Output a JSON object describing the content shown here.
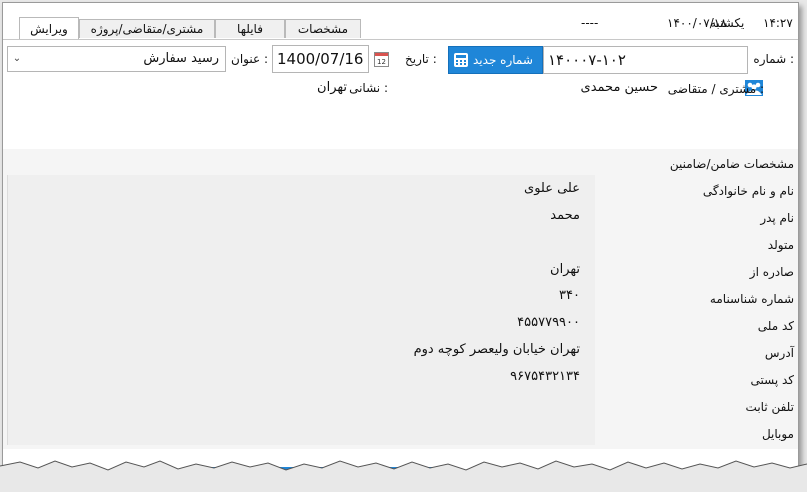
{
  "header": {
    "time": "۱۴:۲۷",
    "day": "یکشنبه",
    "date": "۱۴۰۰/۰۷/۱۸",
    "dashes": "----"
  },
  "tabs": [
    {
      "label": "ویرایش",
      "active": true
    },
    {
      "label": "مشتری/متقاضی/پروژه",
      "active": false
    },
    {
      "label": "فایلها",
      "active": false
    },
    {
      "label": "مشخصات",
      "active": false
    }
  ],
  "form": {
    "number_label": "شماره :",
    "number_value": "۱۴۰۰۰۷-۱۰۲",
    "new_number_button": "شماره جدید",
    "date_label": "تاریخ :",
    "date_value": "1400/07/16",
    "title_label": "عنوان :",
    "title_value": "رسید سفارش",
    "customer_label": "مشتری / متقاضی :",
    "customer_value": "حسین محمدی",
    "address_label": "نشانی :",
    "address_value": "تهران"
  },
  "guarantor": {
    "section_title": "مشخصات ضامن/ضامنین",
    "fields": [
      {
        "label": "نام و نام خانوادگی",
        "value": "علی علوی"
      },
      {
        "label": "نام پدر",
        "value": "محمد"
      },
      {
        "label": "متولد",
        "value": ""
      },
      {
        "label": "صادره از",
        "value": "تهران"
      },
      {
        "label": "شماره شناسنامه",
        "value": "۳۴۰"
      },
      {
        "label": "کد ملی",
        "value": "۴۵۵۷۷۹۹۰۰"
      },
      {
        "label": "آدرس",
        "value": "تهران خیابان ولیعصر کوچه دوم"
      },
      {
        "label": "کد پستی",
        "value": "۹۶۷۵۴۳۲۱۳۴"
      },
      {
        "label": "تلفن ثابت",
        "value": ""
      },
      {
        "label": "موبایل",
        "value": ""
      }
    ]
  },
  "colors": {
    "accent": "#1f86d8",
    "panel": "#efefef"
  }
}
